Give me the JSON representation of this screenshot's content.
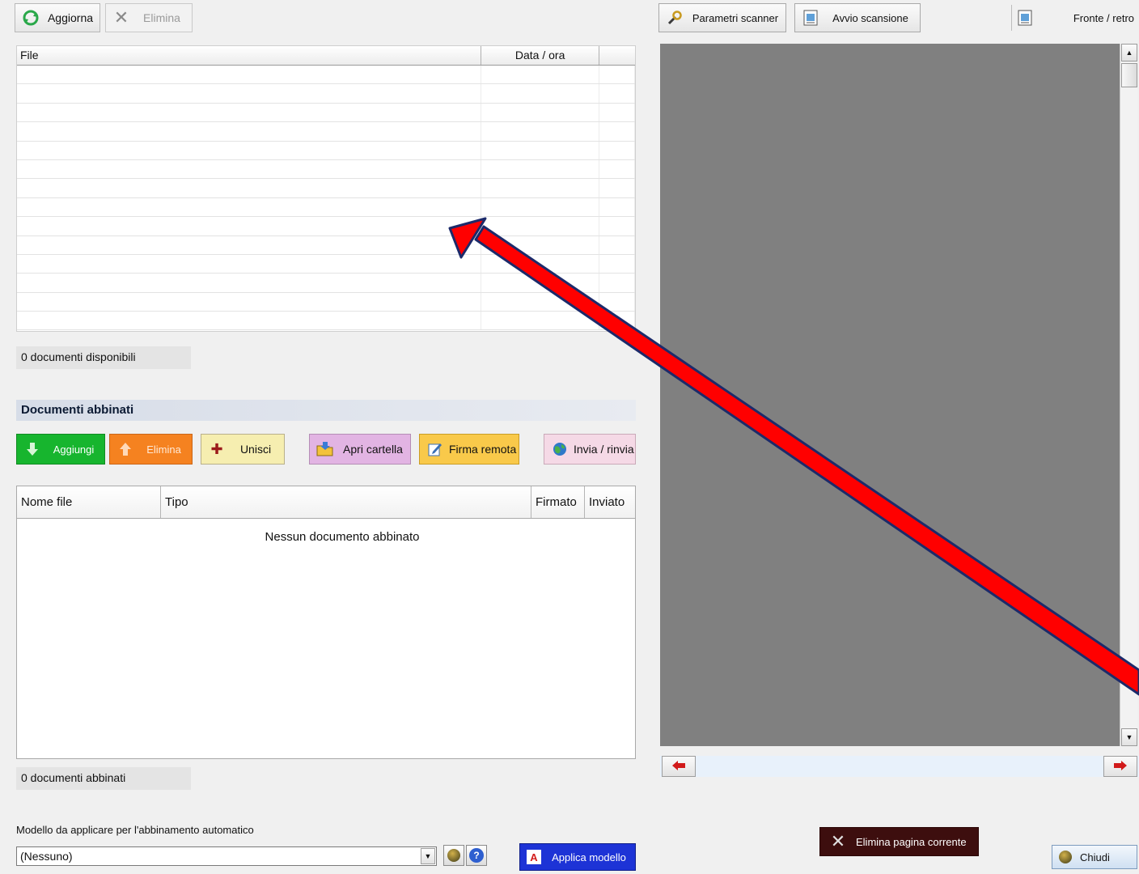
{
  "toolbar_left": {
    "refresh_label": "Aggiorna",
    "delete_label": "Elimina"
  },
  "toolbar_right": {
    "scanner_params_label": "Parametri scanner",
    "start_scan_label": "Avvio scansione",
    "duplex_label": "Fronte / retro"
  },
  "file_list": {
    "columns": [
      "File",
      "Data / ora"
    ],
    "row_count": 14
  },
  "available_count": "0 documenti disponibili",
  "associated": {
    "section_title": "Documenti abbinati",
    "buttons": {
      "add": "Aggiungi",
      "remove": "Elimina",
      "merge": "Unisci",
      "open_folder": "Apri cartella",
      "remote_sign": "Firma remota",
      "send": "Invia / rinvia"
    },
    "columns": [
      "Nome file",
      "Tipo",
      "Firmato",
      "Inviato"
    ],
    "empty_message": "Nessun documento abbinato",
    "count": "0 documenti abbinati"
  },
  "template": {
    "label": "Modello da applicare per l'abbinamento automatico",
    "selected": "(Nessuno)",
    "apply_label": "Applica modello"
  },
  "preview": {
    "delete_page_label": "Elimina pagina corrente"
  },
  "close_label": "Chiudi",
  "colors": {
    "add_green": "#17b52e",
    "remove_orange": "#f58220",
    "merge_yellow": "#f6eeb0",
    "open_folder_pink": "#e2b4e3",
    "remote_sign_yellow": "#f9c94a",
    "send_pink": "#f5d9e6",
    "apply_blue": "#1d33d6",
    "preview_gray": "#808080",
    "annotation_red": "#ff0000"
  }
}
